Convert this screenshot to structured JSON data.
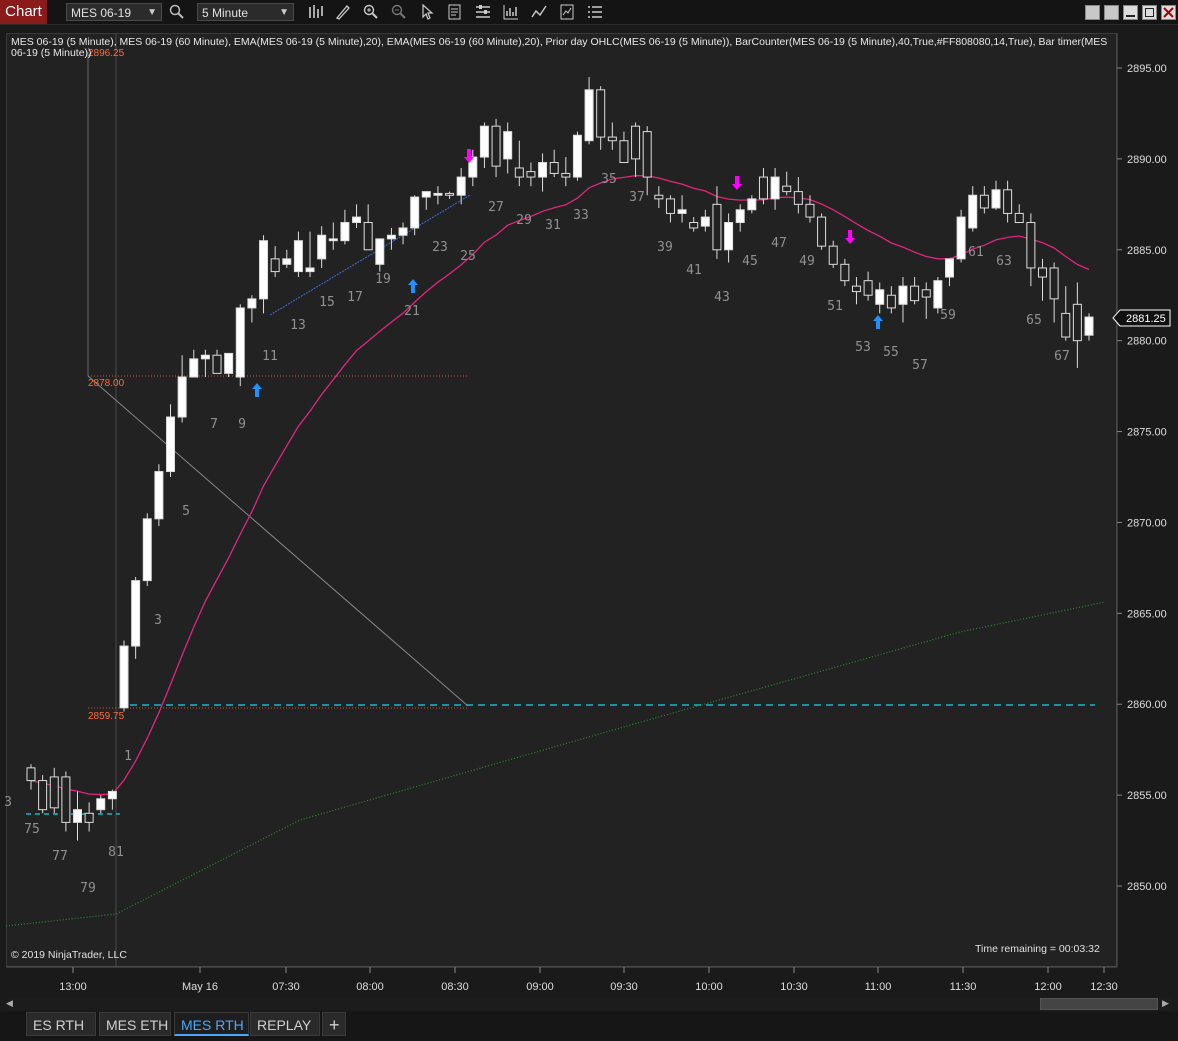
{
  "toolbar": {
    "chart_tab": "Chart",
    "instrument": "MES 06-19",
    "interval": "5 Minute",
    "icons": [
      "search-icon",
      "bars-type-icon",
      "draw-icon",
      "zoom-in-icon",
      "zoom-out-icon",
      "pointer-icon",
      "data-box-icon",
      "properties-icon",
      "strategy-icon",
      "indicator-icon",
      "template-icon",
      "more-icon"
    ],
    "window_buttons": [
      "minimize-icon",
      "restore-icon",
      "maximize-icon",
      "close-icon"
    ]
  },
  "legend": "MES 06-19 (5 Minute), MES 06-19 (60 Minute), EMA(MES 06-19 (5 Minute),20), EMA(MES 06-19 (60 Minute),20), Prior day OHLC(MES 06-19 (5 Minute)), BarCounter(MES 06-19 (5 Minute),40,True,#FF808080,14,True), Bar timer(MES 06-19 (5 Minute))",
  "copyright": "© 2019 NinjaTrader, LLC",
  "timer": "Time remaining = 00:03:32",
  "last_price": "2881.25",
  "price_labels": {
    "high": "2896.25",
    "mid": "2878.00",
    "low": "2859.75"
  },
  "colors": {
    "up_candle": "#ffffff",
    "down_candle": "#222222",
    "ema_fast": "#e0267f",
    "ema_slow": "#2e8b2e",
    "prior_ohlc": "#ff6a3a",
    "teal": "#19b5c8",
    "buy_arrow": "#1e90ff",
    "sell_arrow": "#ff00ff"
  },
  "chart_data": {
    "type": "candlestick",
    "y_ticks": [
      "2895.00",
      "2890.00",
      "2885.00",
      "2880.00",
      "2875.00",
      "2870.00",
      "2865.00",
      "2860.00",
      "2855.00",
      "2850.00"
    ],
    "x_ticks": [
      "13:00",
      "May 16",
      "07:30",
      "08:00",
      "08:30",
      "09:00",
      "09:30",
      "10:00",
      "10:30",
      "11:00",
      "11:30",
      "12:00",
      "12:30"
    ],
    "bar_counter_labels": [
      "3",
      "75",
      "77",
      "79",
      "81",
      "1",
      "3",
      "5",
      "7",
      "9",
      "11",
      "13",
      "15",
      "17",
      "19",
      "21",
      "23",
      "25",
      "27",
      "29",
      "31",
      "33",
      "35",
      "37",
      "39",
      "41",
      "43",
      "45",
      "47",
      "49",
      "51",
      "53",
      "55",
      "57",
      "59",
      "61",
      "63",
      "65",
      "67"
    ],
    "candles": [
      [
        2856.5,
        2856.7,
        2855.3,
        2855.8
      ],
      [
        2855.8,
        2856.1,
        2854.0,
        2854.2
      ],
      [
        2856.0,
        2856.5,
        2854.0,
        2854.3
      ],
      [
        2856.0,
        2856.3,
        2853.0,
        2853.5
      ],
      [
        2853.5,
        2855.2,
        2852.5,
        2854.2
      ],
      [
        2854.0,
        2854.6,
        2853.0,
        2853.5
      ],
      [
        2854.2,
        2855.0,
        2854.0,
        2854.8
      ],
      [
        2854.8,
        2855.3,
        2854.2,
        2855.2
      ],
      [
        2859.8,
        2863.5,
        2859.6,
        2863.2
      ],
      [
        2863.2,
        2867.0,
        2862.5,
        2866.8
      ],
      [
        2866.8,
        2870.5,
        2866.5,
        2870.2
      ],
      [
        2870.2,
        2873.2,
        2869.8,
        2872.8
      ],
      [
        2872.8,
        2876.5,
        2872.5,
        2875.8
      ],
      [
        2875.8,
        2879.2,
        2875.5,
        2878.0
      ],
      [
        2878.0,
        2879.5,
        2878.0,
        2879.0
      ],
      [
        2879.0,
        2879.5,
        2878.0,
        2879.2
      ],
      [
        2879.2,
        2879.5,
        2878.2,
        2878.2
      ],
      [
        2878.2,
        2879.0,
        2878.0,
        2879.3
      ],
      [
        2878.0,
        2882.0,
        2877.5,
        2881.8
      ],
      [
        2881.8,
        2882.5,
        2881.0,
        2882.3
      ],
      [
        2882.3,
        2885.8,
        2881.5,
        2885.5
      ],
      [
        2884.5,
        2885.2,
        2883.5,
        2883.8
      ],
      [
        2884.2,
        2885.0,
        2884.0,
        2884.5
      ],
      [
        2883.8,
        2886.0,
        2883.5,
        2885.5
      ],
      [
        2883.8,
        2886.0,
        2883.5,
        2884.0
      ],
      [
        2884.5,
        2886.3,
        2884.0,
        2885.8
      ],
      [
        2885.5,
        2886.5,
        2885.0,
        2885.6
      ],
      [
        2885.5,
        2887.2,
        2885.3,
        2886.5
      ],
      [
        2886.5,
        2887.5,
        2886.2,
        2886.8
      ],
      [
        2886.5,
        2887.5,
        2885.5,
        2885.0
      ],
      [
        2884.2,
        2885.5,
        2883.8,
        2885.6
      ],
      [
        2885.6,
        2886.2,
        2885.0,
        2885.8
      ],
      [
        2885.8,
        2886.5,
        2885.3,
        2886.2
      ],
      [
        2886.2,
        2888.0,
        2885.8,
        2887.9
      ],
      [
        2887.9,
        2888.2,
        2887.2,
        2888.2
      ],
      [
        2888.0,
        2888.5,
        2887.5,
        2888.1
      ],
      [
        2888.1,
        2888.2,
        2887.8,
        2888.0
      ],
      [
        2888.0,
        2889.5,
        2887.5,
        2889.0
      ],
      [
        2889.0,
        2890.5,
        2888.5,
        2890.1
      ],
      [
        2890.1,
        2892.0,
        2889.5,
        2891.8
      ],
      [
        2891.8,
        2892.2,
        2889.0,
        2889.6
      ],
      [
        2890.0,
        2892.0,
        2889.2,
        2891.5
      ],
      [
        2889.5,
        2891.0,
        2888.5,
        2889.0
      ],
      [
        2889.3,
        2889.8,
        2888.5,
        2889.0
      ],
      [
        2889.0,
        2890.3,
        2888.2,
        2889.8
      ],
      [
        2889.8,
        2890.5,
        2889.0,
        2889.2
      ],
      [
        2889.2,
        2890.1,
        2888.5,
        2889.0
      ],
      [
        2889.0,
        2891.5,
        2888.8,
        2891.3
      ],
      [
        2891.0,
        2894.5,
        2890.8,
        2893.8
      ],
      [
        2893.8,
        2894.0,
        2890.5,
        2891.2
      ],
      [
        2891.2,
        2892.0,
        2890.5,
        2891.0
      ],
      [
        2891.0,
        2891.5,
        2890.0,
        2889.8
      ],
      [
        2891.8,
        2892.0,
        2889.0,
        2890.0
      ],
      [
        2891.5,
        2891.8,
        2888.0,
        2889.0
      ],
      [
        2888.0,
        2888.5,
        2887.3,
        2887.8
      ],
      [
        2887.8,
        2888.0,
        2886.5,
        2887.0
      ],
      [
        2887.0,
        2888.0,
        2886.5,
        2887.2
      ],
      [
        2886.5,
        2886.8,
        2886.0,
        2886.2
      ],
      [
        2886.3,
        2887.2,
        2886.0,
        2886.8
      ],
      [
        2887.5,
        2888.5,
        2884.5,
        2885.0
      ],
      [
        2885.0,
        2887.0,
        2884.3,
        2886.5
      ],
      [
        2886.5,
        2887.5,
        2886.0,
        2887.2
      ],
      [
        2887.2,
        2888.0,
        2887.0,
        2887.8
      ],
      [
        2889.0,
        2889.5,
        2887.5,
        2887.8
      ],
      [
        2887.8,
        2889.5,
        2887.2,
        2889.0
      ],
      [
        2888.5,
        2889.3,
        2888.0,
        2888.2
      ],
      [
        2888.2,
        2889.0,
        2887.0,
        2887.5
      ],
      [
        2887.5,
        2888.0,
        2886.5,
        2886.8
      ],
      [
        2886.8,
        2887.0,
        2885.0,
        2885.2
      ],
      [
        2885.2,
        2885.5,
        2884.0,
        2884.2
      ],
      [
        2884.2,
        2884.5,
        2883.0,
        2883.3
      ],
      [
        2883.0,
        2883.5,
        2882.0,
        2882.7
      ],
      [
        2883.3,
        2883.8,
        2882.2,
        2882.5
      ],
      [
        2882.0,
        2883.2,
        2881.5,
        2882.8
      ],
      [
        2882.5,
        2883.0,
        2881.5,
        2881.8
      ],
      [
        2882.0,
        2883.5,
        2881.0,
        2883.0
      ],
      [
        2883.0,
        2883.5,
        2882.0,
        2882.2
      ],
      [
        2882.8,
        2883.2,
        2881.2,
        2882.4
      ],
      [
        2881.8,
        2883.5,
        2881.5,
        2883.3
      ],
      [
        2883.5,
        2884.5,
        2883.0,
        2884.5
      ],
      [
        2884.5,
        2887.2,
        2884.3,
        2886.8
      ],
      [
        2886.2,
        2888.5,
        2886.0,
        2888.0
      ],
      [
        2888.0,
        2888.5,
        2887.0,
        2887.3
      ],
      [
        2887.3,
        2888.8,
        2887.2,
        2888.3
      ],
      [
        2888.3,
        2888.8,
        2886.5,
        2887.0
      ],
      [
        2887.0,
        2887.5,
        2886.5,
        2886.5
      ],
      [
        2886.5,
        2887.0,
        2883.0,
        2884.0
      ],
      [
        2884.0,
        2884.5,
        2882.2,
        2883.5
      ],
      [
        2884.0,
        2884.3,
        2881.0,
        2882.3
      ],
      [
        2881.5,
        2883.0,
        2880.0,
        2880.2
      ],
      [
        2882.0,
        2883.2,
        2878.5,
        2880.0
      ],
      [
        2880.3,
        2881.5,
        2880.0,
        2881.3
      ]
    ]
  }
}
